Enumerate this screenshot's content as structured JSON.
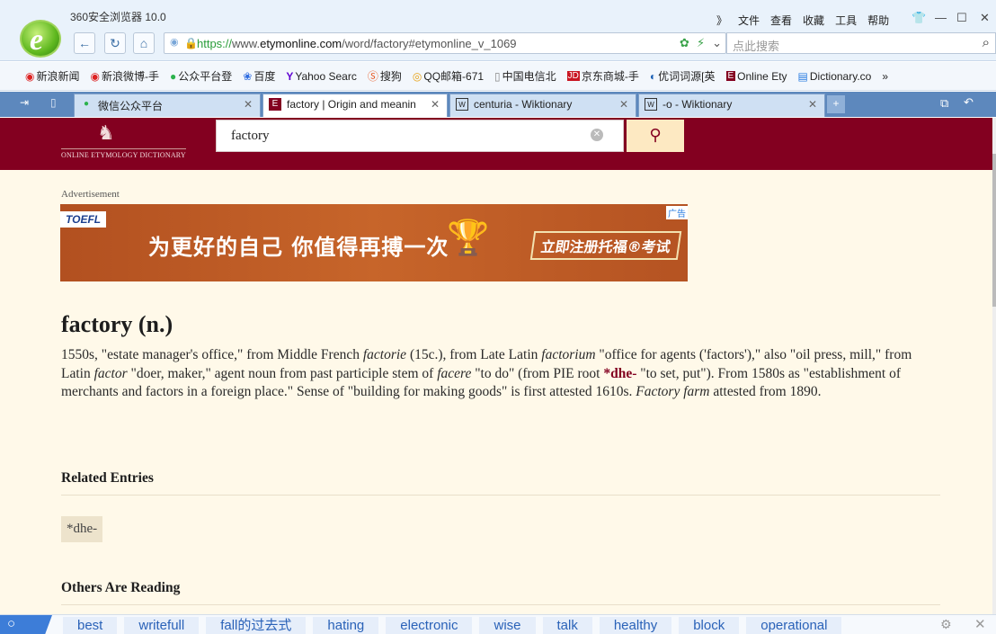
{
  "browser": {
    "title": "360安全浏览器 10.0",
    "menu": [
      "》",
      "文件",
      "查看",
      "收藏",
      "工具",
      "帮助"
    ],
    "url_https": "https://",
    "url_prefix": "www.",
    "url_domain": "etymonline.com",
    "url_path": "/word/factory#etymonline_v_1069",
    "search_placeholder": "点此搜索"
  },
  "bookmarks": [
    {
      "icon": "weibo-icon",
      "label": "新浪新闻"
    },
    {
      "icon": "weibo-icon",
      "label": "新浪微博-手"
    },
    {
      "icon": "wechat-icon",
      "label": "公众平台登"
    },
    {
      "icon": "baidu-icon",
      "label": "百度"
    },
    {
      "icon": "yahoo-icon",
      "label": "Yahoo Searc"
    },
    {
      "icon": "sogou-icon",
      "label": "搜狗"
    },
    {
      "icon": "qq-icon",
      "label": "QQ邮箱-671"
    },
    {
      "icon": "page-icon",
      "label": "中国电信北"
    },
    {
      "icon": "jd-icon",
      "label": "京东商城-手"
    },
    {
      "icon": "youci-icon",
      "label": "优词词源[英"
    },
    {
      "icon": "etym-icon",
      "label": "Online Ety"
    },
    {
      "icon": "dictionary-icon",
      "label": "Dictionary.co"
    }
  ],
  "bookmarks_more": "»",
  "tabs": [
    {
      "label": "微信公众平台",
      "icon": "wechat-icon",
      "active": false
    },
    {
      "label": "factory | Origin and meanin",
      "icon": "etym-icon",
      "active": true
    },
    {
      "label": "centuria - Wiktionary",
      "icon": "wiki-icon",
      "active": false
    },
    {
      "label": "-o - Wiktionary",
      "icon": "wiki-icon",
      "active": false
    }
  ],
  "site": {
    "logo_text": "ONLINE ETYMOLOGY DICTIONARY",
    "search_value": "factory"
  },
  "ad": {
    "label": "Advertisement",
    "brand": "TOEFL",
    "tag": "广告",
    "slogan": "为更好的自己 你值得再搏一次",
    "cta": "立即注册托福®考试"
  },
  "entry": {
    "title": "factory (n.)",
    "def_1": "1550s, \"estate manager's office,\" from Middle French ",
    "def_2": "factorie",
    "def_3": " (15c.), from Late Latin ",
    "def_4": "factorium",
    "def_5": " \"office for agents ('factors'),\" also \"oil press, mill,\" from Latin ",
    "def_6": "factor",
    "def_7": " \"doer, maker,\" agent noun from past participle stem of ",
    "def_8": "facere",
    "def_9": " \"to do\" (from PIE root ",
    "def_10": "*dhe-",
    "def_11": " \"to set, put\"). From 1580s as \"establishment of merchants and factors in a foreign place.\" Sense of \"building for making goods\" is first attested 1610s. ",
    "def_12": "Factory farm",
    "def_13": " attested from 1890."
  },
  "related": {
    "title": "Related Entries",
    "items": [
      "*dhe-"
    ]
  },
  "others": {
    "title": "Others Are Reading"
  },
  "hotwords": [
    "best",
    "writefull",
    "fall的过去式",
    "hating",
    "electronic",
    "wise",
    "talk",
    "healthy",
    "block",
    "operational"
  ]
}
